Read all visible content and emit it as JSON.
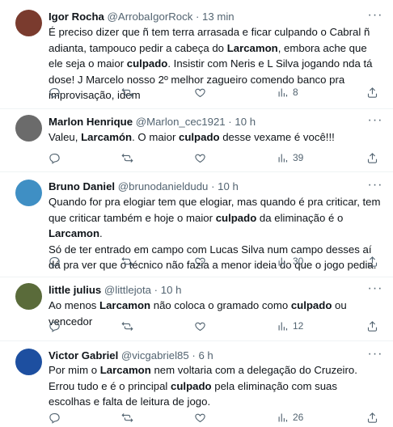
{
  "tweets": [
    {
      "name": "Igor Rocha",
      "handle": "@ArrobaIgorRock",
      "time": "13 min",
      "segments": [
        {
          "text": "É preciso dizer que ñ tem terra arrasada e ficar culpando o Cabral ñ adianta, tampouco pedir a cabeça do ",
          "bold": false
        },
        {
          "text": "Larcamon",
          "bold": true
        },
        {
          "text": ", embora ache que ele seja o maior ",
          "bold": false
        },
        {
          "text": "culpado",
          "bold": true
        },
        {
          "text": ". Insistir com Neris e L Silva jogando nda tá dose! J Marcelo nosso 2º melhor zagueiro comendo banco pra improvisação, idem",
          "bold": false
        }
      ],
      "views": "8",
      "avatar_color": "#7a3b2e"
    },
    {
      "name": "Marlon Henrique",
      "handle": "@Marlon_cec1921",
      "time": "10 h",
      "segments": [
        {
          "text": "Valeu, ",
          "bold": false
        },
        {
          "text": "Larcamón",
          "bold": true
        },
        {
          "text": ". O maior ",
          "bold": false
        },
        {
          "text": "culpado",
          "bold": true
        },
        {
          "text": " desse vexame é você!!!",
          "bold": false
        }
      ],
      "views": "39",
      "avatar_color": "#6b6b6b"
    },
    {
      "name": "Bruno Daniel",
      "handle": "@brunodanieldudu",
      "time": "10 h",
      "segments": [
        {
          "text": "Quando for pra elogiar tem que elogiar, mas quando é pra criticar, tem que criticar também e hoje o maior ",
          "bold": false
        },
        {
          "text": "culpado",
          "bold": true
        },
        {
          "text": " da eliminação é o ",
          "bold": false
        },
        {
          "text": "Larcamon",
          "bold": true
        },
        {
          "text": ".\nSó de ter entrado em campo com Lucas Silva num campo desses aí dá pra ver que o técnico não fazia a menor ideia do que o jogo pedia.",
          "bold": false
        }
      ],
      "views": "30",
      "avatar_color": "#3f8fc4"
    },
    {
      "name": "little julius",
      "handle": "@littlejota",
      "time": "10 h",
      "segments": [
        {
          "text": "Ao menos ",
          "bold": false
        },
        {
          "text": "Larcamon",
          "bold": true
        },
        {
          "text": " não coloca o gramado como ",
          "bold": false
        },
        {
          "text": "culpado",
          "bold": true
        },
        {
          "text": " ou vencedor",
          "bold": false
        }
      ],
      "views": "12",
      "avatar_color": "#5a6b3a"
    },
    {
      "name": "Victor Gabriel",
      "handle": "@vicgabriel85",
      "time": "6 h",
      "segments": [
        {
          "text": "Por mim o ",
          "bold": false
        },
        {
          "text": "Larcamon",
          "bold": true
        },
        {
          "text": " nem voltaria com a delegação do Cruzeiro. Errou tudo e é o principal ",
          "bold": false
        },
        {
          "text": "culpado",
          "bold": true
        },
        {
          "text": " pela eliminação com suas escolhas e falta de leitura de jogo.",
          "bold": false
        }
      ],
      "views": "26",
      "avatar_color": "#1d4fa0"
    }
  ],
  "icons": {
    "reply": "reply-icon",
    "retweet": "retweet-icon",
    "like": "like-icon",
    "views": "views-icon",
    "share": "share-icon",
    "more": "more-icon"
  }
}
